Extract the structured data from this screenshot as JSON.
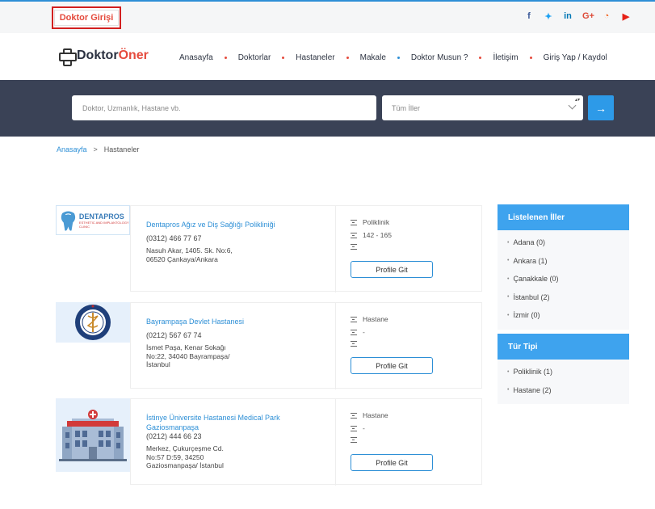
{
  "topbar": {
    "login_label": "Doktor Girişi",
    "socials": [
      {
        "name": "facebook-icon",
        "glyph": "f"
      },
      {
        "name": "twitter-icon",
        "glyph": "🐦"
      },
      {
        "name": "linkedin-icon",
        "glyph": "in"
      },
      {
        "name": "google-plus-icon",
        "glyph": "G+"
      },
      {
        "name": "rss-icon",
        "glyph": "⊃"
      },
      {
        "name": "youtube-icon",
        "glyph": "▶"
      }
    ]
  },
  "header": {
    "logo_part1": "Doktor",
    "logo_part2": "Öner",
    "nav": [
      "Anasayfa",
      "Doktorlar",
      "Hastaneler",
      "Makale",
      "Doktor Musun ?",
      "İletişim",
      "Giriş Yap / Kaydol"
    ]
  },
  "search": {
    "placeholder": "Doktor, Uzmanlık, Hastane vb.",
    "city_selected": "Tüm İller",
    "go_icon": "→"
  },
  "breadcrumb": {
    "home": "Anasayfa",
    "sep": ">",
    "current": "Hastaneler"
  },
  "listings": [
    {
      "name": "Dentapros Ağız ve Diş Sağlığı Polikliniği",
      "phone": "(0312) 466 77 67",
      "address": "Nasuh Akar, 1405. Sk. No:6, 06520 Çankaya/Ankara",
      "type": "Poliklinik",
      "extra": "142 - 165",
      "extra2": "",
      "button": "Profile Git",
      "logo_title": "DENTAPROS",
      "logo_sub": "ESTHETIC AND IMPLANTOLOGY CLINIC"
    },
    {
      "name": "Bayrampaşa Devlet Hastanesi",
      "phone": "(0212) 567 67 74",
      "address": "İsmet Paşa, Kenar Sokağı No:22, 34040 Bayrampaşa/İstanbul",
      "type": "Hastane",
      "extra": "-",
      "extra2": "",
      "button": "Profile Git"
    },
    {
      "name": "İstinye Üniversite Hastanesi Medical Park Gaziosmanpaşa",
      "phone": "(0212) 444 66 23",
      "address": "Merkez, Çukurçeşme Cd. No:57 D:59, 34250 Gaziosmanpaşa/ İstanbul",
      "type": "Hastane",
      "extra": "-",
      "extra2": "",
      "button": "Profile Git"
    }
  ],
  "sidebar": {
    "cities_title": "Listelenen İller",
    "cities": [
      "Adana (0)",
      "Ankara (1)",
      "Çanakkale (0)",
      "İstanbul (2)",
      "İzmir (0)"
    ],
    "types_title": "Tür Tipi",
    "types": [
      "Poliklinik (1)",
      "Hastane (2)"
    ]
  },
  "colors": {
    "accent": "#2d8fd6",
    "brand_red": "#e54b3d",
    "band": "#3a4256",
    "side_head": "#3ea3ee"
  }
}
